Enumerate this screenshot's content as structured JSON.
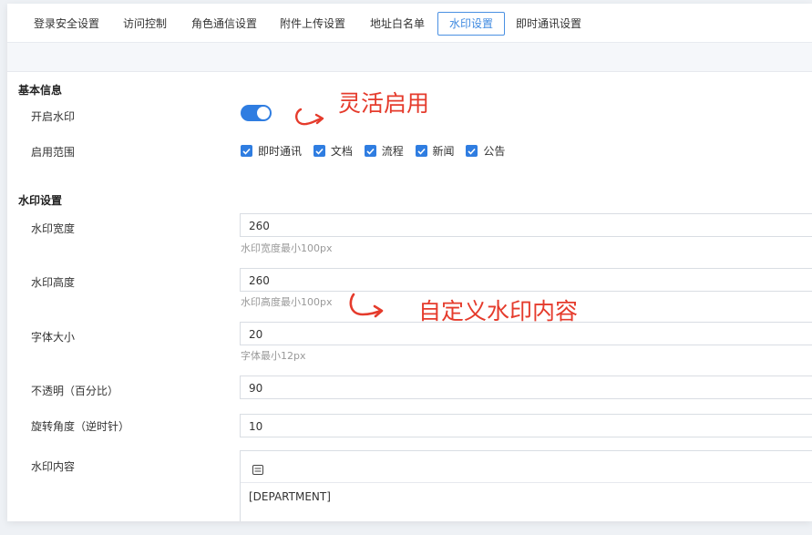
{
  "tabs": [
    {
      "label": "登录安全设置",
      "active": false
    },
    {
      "label": "访问控制",
      "active": false
    },
    {
      "label": "角色通信设置",
      "active": false
    },
    {
      "label": "附件上传设置",
      "active": false
    },
    {
      "label": "地址白名单",
      "active": false
    },
    {
      "label": "水印设置",
      "active": true
    },
    {
      "label": "即时通讯设置",
      "active": false
    }
  ],
  "basic": {
    "section_title": "基本信息",
    "enable_label": "开启水印",
    "enable_on": true,
    "scope_label": "启用范围",
    "scope_options": [
      {
        "label": "即时通讯",
        "checked": true
      },
      {
        "label": "文档",
        "checked": true
      },
      {
        "label": "流程",
        "checked": true
      },
      {
        "label": "新闻",
        "checked": true
      },
      {
        "label": "公告",
        "checked": true
      }
    ]
  },
  "settings": {
    "section_title": "水印设置",
    "width_label": "水印宽度",
    "width_value": "260",
    "width_hint": "水印宽度最小100px",
    "height_label": "水印高度",
    "height_value": "260",
    "height_hint": "水印高度最小100px",
    "font_label": "字体大小",
    "font_value": "20",
    "font_hint": "字体最小12px",
    "opacity_label": "不透明（百分比）",
    "opacity_value": "90",
    "rotation_label": "旋转角度（逆时针）",
    "rotation_value": "10",
    "content_label": "水印内容",
    "content_value": "[DEPARTMENT]"
  },
  "annotations": {
    "flexible": "灵活启用",
    "custom": "自定义水印内容"
  },
  "colors": {
    "accent": "#2f7de1",
    "annotation": "#e53b2c"
  }
}
